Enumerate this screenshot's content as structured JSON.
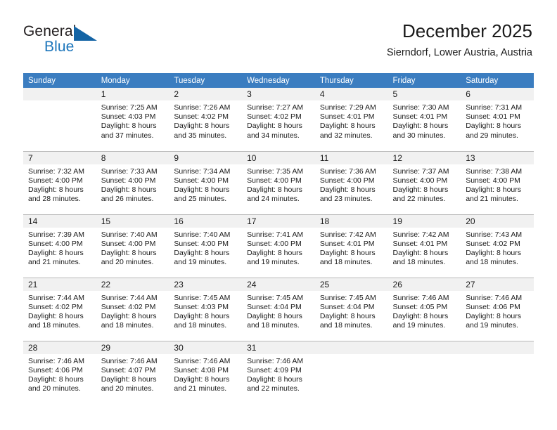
{
  "brand": {
    "name_primary": "General",
    "name_secondary": "Blue",
    "triangle_color": "#1464a5",
    "secondary_color": "#1b75bb"
  },
  "header": {
    "title": "December 2025",
    "subtitle": "Sierndorf, Lower Austria, Austria"
  },
  "theme": {
    "header_row_background": "#3b7dc0",
    "header_row_text": "#ffffff",
    "daynum_background": "#f1f1f1",
    "grid_line": "#b9b9b9",
    "body_text": "#1a1a1a"
  },
  "calendar": {
    "weekday_headers": [
      "Sunday",
      "Monday",
      "Tuesday",
      "Wednesday",
      "Thursday",
      "Friday",
      "Saturday"
    ],
    "weeks": [
      [
        {
          "day": "",
          "lines": []
        },
        {
          "day": "1",
          "lines": [
            "Sunrise: 7:25 AM",
            "Sunset: 4:03 PM",
            "Daylight: 8 hours",
            "and 37 minutes."
          ]
        },
        {
          "day": "2",
          "lines": [
            "Sunrise: 7:26 AM",
            "Sunset: 4:02 PM",
            "Daylight: 8 hours",
            "and 35 minutes."
          ]
        },
        {
          "day": "3",
          "lines": [
            "Sunrise: 7:27 AM",
            "Sunset: 4:02 PM",
            "Daylight: 8 hours",
            "and 34 minutes."
          ]
        },
        {
          "day": "4",
          "lines": [
            "Sunrise: 7:29 AM",
            "Sunset: 4:01 PM",
            "Daylight: 8 hours",
            "and 32 minutes."
          ]
        },
        {
          "day": "5",
          "lines": [
            "Sunrise: 7:30 AM",
            "Sunset: 4:01 PM",
            "Daylight: 8 hours",
            "and 30 minutes."
          ]
        },
        {
          "day": "6",
          "lines": [
            "Sunrise: 7:31 AM",
            "Sunset: 4:01 PM",
            "Daylight: 8 hours",
            "and 29 minutes."
          ]
        }
      ],
      [
        {
          "day": "7",
          "lines": [
            "Sunrise: 7:32 AM",
            "Sunset: 4:00 PM",
            "Daylight: 8 hours",
            "and 28 minutes."
          ]
        },
        {
          "day": "8",
          "lines": [
            "Sunrise: 7:33 AM",
            "Sunset: 4:00 PM",
            "Daylight: 8 hours",
            "and 26 minutes."
          ]
        },
        {
          "day": "9",
          "lines": [
            "Sunrise: 7:34 AM",
            "Sunset: 4:00 PM",
            "Daylight: 8 hours",
            "and 25 minutes."
          ]
        },
        {
          "day": "10",
          "lines": [
            "Sunrise: 7:35 AM",
            "Sunset: 4:00 PM",
            "Daylight: 8 hours",
            "and 24 minutes."
          ]
        },
        {
          "day": "11",
          "lines": [
            "Sunrise: 7:36 AM",
            "Sunset: 4:00 PM",
            "Daylight: 8 hours",
            "and 23 minutes."
          ]
        },
        {
          "day": "12",
          "lines": [
            "Sunrise: 7:37 AM",
            "Sunset: 4:00 PM",
            "Daylight: 8 hours",
            "and 22 minutes."
          ]
        },
        {
          "day": "13",
          "lines": [
            "Sunrise: 7:38 AM",
            "Sunset: 4:00 PM",
            "Daylight: 8 hours",
            "and 21 minutes."
          ]
        }
      ],
      [
        {
          "day": "14",
          "lines": [
            "Sunrise: 7:39 AM",
            "Sunset: 4:00 PM",
            "Daylight: 8 hours",
            "and 21 minutes."
          ]
        },
        {
          "day": "15",
          "lines": [
            "Sunrise: 7:40 AM",
            "Sunset: 4:00 PM",
            "Daylight: 8 hours",
            "and 20 minutes."
          ]
        },
        {
          "day": "16",
          "lines": [
            "Sunrise: 7:40 AM",
            "Sunset: 4:00 PM",
            "Daylight: 8 hours",
            "and 19 minutes."
          ]
        },
        {
          "day": "17",
          "lines": [
            "Sunrise: 7:41 AM",
            "Sunset: 4:00 PM",
            "Daylight: 8 hours",
            "and 19 minutes."
          ]
        },
        {
          "day": "18",
          "lines": [
            "Sunrise: 7:42 AM",
            "Sunset: 4:01 PM",
            "Daylight: 8 hours",
            "and 18 minutes."
          ]
        },
        {
          "day": "19",
          "lines": [
            "Sunrise: 7:42 AM",
            "Sunset: 4:01 PM",
            "Daylight: 8 hours",
            "and 18 minutes."
          ]
        },
        {
          "day": "20",
          "lines": [
            "Sunrise: 7:43 AM",
            "Sunset: 4:02 PM",
            "Daylight: 8 hours",
            "and 18 minutes."
          ]
        }
      ],
      [
        {
          "day": "21",
          "lines": [
            "Sunrise: 7:44 AM",
            "Sunset: 4:02 PM",
            "Daylight: 8 hours",
            "and 18 minutes."
          ]
        },
        {
          "day": "22",
          "lines": [
            "Sunrise: 7:44 AM",
            "Sunset: 4:02 PM",
            "Daylight: 8 hours",
            "and 18 minutes."
          ]
        },
        {
          "day": "23",
          "lines": [
            "Sunrise: 7:45 AM",
            "Sunset: 4:03 PM",
            "Daylight: 8 hours",
            "and 18 minutes."
          ]
        },
        {
          "day": "24",
          "lines": [
            "Sunrise: 7:45 AM",
            "Sunset: 4:04 PM",
            "Daylight: 8 hours",
            "and 18 minutes."
          ]
        },
        {
          "day": "25",
          "lines": [
            "Sunrise: 7:45 AM",
            "Sunset: 4:04 PM",
            "Daylight: 8 hours",
            "and 18 minutes."
          ]
        },
        {
          "day": "26",
          "lines": [
            "Sunrise: 7:46 AM",
            "Sunset: 4:05 PM",
            "Daylight: 8 hours",
            "and 19 minutes."
          ]
        },
        {
          "day": "27",
          "lines": [
            "Sunrise: 7:46 AM",
            "Sunset: 4:06 PM",
            "Daylight: 8 hours",
            "and 19 minutes."
          ]
        }
      ],
      [
        {
          "day": "28",
          "lines": [
            "Sunrise: 7:46 AM",
            "Sunset: 4:06 PM",
            "Daylight: 8 hours",
            "and 20 minutes."
          ]
        },
        {
          "day": "29",
          "lines": [
            "Sunrise: 7:46 AM",
            "Sunset: 4:07 PM",
            "Daylight: 8 hours",
            "and 20 minutes."
          ]
        },
        {
          "day": "30",
          "lines": [
            "Sunrise: 7:46 AM",
            "Sunset: 4:08 PM",
            "Daylight: 8 hours",
            "and 21 minutes."
          ]
        },
        {
          "day": "31",
          "lines": [
            "Sunrise: 7:46 AM",
            "Sunset: 4:09 PM",
            "Daylight: 8 hours",
            "and 22 minutes."
          ]
        },
        {
          "day": "",
          "lines": []
        },
        {
          "day": "",
          "lines": []
        },
        {
          "day": "",
          "lines": []
        }
      ]
    ]
  }
}
